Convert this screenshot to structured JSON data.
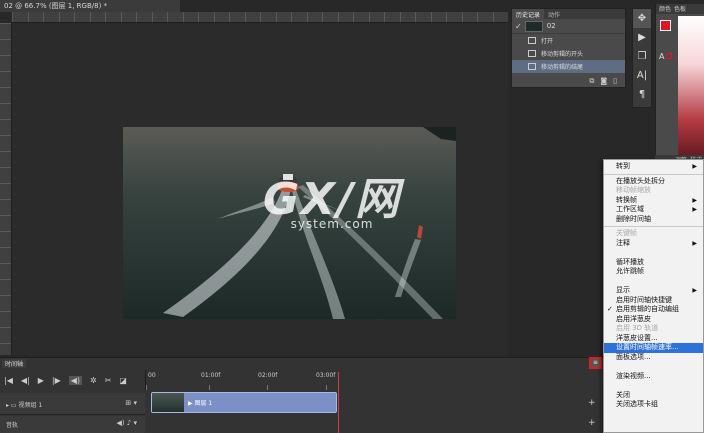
{
  "document": {
    "tab_title": "02 @ 66.7% (图层 1, RGB/8) *"
  },
  "watermark": {
    "big": "GX/网",
    "small": "system.com"
  },
  "history": {
    "tabs": [
      "历史记录",
      "动作"
    ],
    "snapshot_name": "02",
    "items": [
      {
        "label": "打开"
      },
      {
        "label": "移动剪辑的开头"
      },
      {
        "label": "移动剪辑的结尾"
      }
    ]
  },
  "color_panel": {
    "tabs": [
      "颜色",
      "色板"
    ],
    "a_label": "A",
    "lower_tabs": [
      "调整",
      "样式"
    ],
    "fg_color": "#e5121f"
  },
  "tools": {
    "icons": [
      "move-tool-icon",
      "play-icon",
      "layers-icon",
      "text-tool-icon",
      "paragraph-icon"
    ]
  },
  "context_menu": {
    "items": [
      {
        "label": "转到",
        "submenu": true
      },
      {
        "sep": true
      },
      {
        "label": "在播放头处拆分"
      },
      {
        "label": "移动帧缩放",
        "disabled": true
      },
      {
        "label": "转换帧",
        "submenu": true
      },
      {
        "label": "工作区域",
        "submenu": true
      },
      {
        "label": "删除时间轴"
      },
      {
        "sep": true
      },
      {
        "label": "关键帧",
        "disabled": true
      },
      {
        "label": "注释",
        "submenu": true
      },
      {
        "spacer": true
      },
      {
        "label": "循环播放"
      },
      {
        "label": "允许跳帧"
      },
      {
        "spacer": true
      },
      {
        "label": "显示",
        "submenu": true
      },
      {
        "label": "启用时间轴快捷键"
      },
      {
        "label": "启用剪辑的自动编组",
        "checked": true
      },
      {
        "label": "启用洋葱皮"
      },
      {
        "label": "启用 3D 轨道",
        "disabled": true
      },
      {
        "label": "洋葱皮设置..."
      },
      {
        "label": "设置时间轴帧速率...",
        "highlighted": true
      },
      {
        "label": "面板选项..."
      },
      {
        "spacer": true
      },
      {
        "label": "渲染视频..."
      },
      {
        "spacer": true
      },
      {
        "label": "关闭"
      },
      {
        "label": "关闭选项卡组"
      }
    ]
  },
  "timeline": {
    "tab_label": "时间轴",
    "ticks": [
      "00",
      "01:00f",
      "02:00f",
      "03:00f"
    ],
    "track_video": "视频组 1",
    "track_audio": "音轨",
    "clip_label": "▶ 图层 1"
  }
}
